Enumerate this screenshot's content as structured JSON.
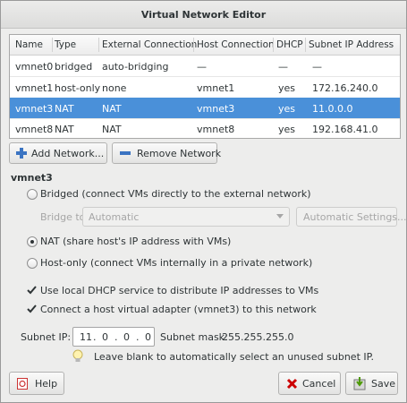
{
  "window": {
    "title": "Virtual Network Editor"
  },
  "table": {
    "columns": [
      "Name",
      "Type",
      "External Connection",
      "Host Connection",
      "DHCP",
      "Subnet IP Address"
    ],
    "rows": [
      {
        "name": "vmnet0",
        "type": "bridged",
        "external": "auto-bridging",
        "host": "—",
        "dhcp": "—",
        "subnet": "—"
      },
      {
        "name": "vmnet1",
        "type": "host-only",
        "external": "none",
        "host": "vmnet1",
        "dhcp": "yes",
        "subnet": "172.16.240.0"
      },
      {
        "name": "vmnet3",
        "type": "NAT",
        "external": "NAT",
        "host": "vmnet3",
        "dhcp": "yes",
        "subnet": "11.0.0.0"
      },
      {
        "name": "vmnet8",
        "type": "NAT",
        "external": "NAT",
        "host": "vmnet8",
        "dhcp": "yes",
        "subnet": "192.168.41.0"
      }
    ],
    "selected_row": "vmnet3"
  },
  "actions": {
    "add_network": "Add Network...",
    "remove_network": "Remove Network"
  },
  "details": {
    "section_title": "vmnet3",
    "bridged_option": "Bridged (connect VMs directly to the external network)",
    "bridge_to_label": "Bridge to:",
    "bridge_to_value": "Automatic",
    "automatic_settings": "Automatic Settings...",
    "nat_option": "NAT (share host's IP address with VMs)",
    "hostonly_option": "Host-only (connect VMs internally in a private network)",
    "selected_mode": "NAT",
    "dhcp_check": "Use local DHCP service to distribute IP addresses to VMs",
    "dhcp_checked": true,
    "adapter_check": "Connect a host virtual adapter (vmnet3) to this network",
    "adapter_checked": true,
    "subnet_ip_label": "Subnet IP:",
    "subnet_ip_octets": [
      "11",
      "0",
      "0",
      "0"
    ],
    "subnet_mask_label": "Subnet mask:",
    "subnet_mask_value": "255.255.255.0",
    "hint": "Leave blank to automatically select an unused subnet IP."
  },
  "footer": {
    "help": "Help",
    "cancel": "Cancel",
    "save": "Save"
  },
  "colors": {
    "selection": "#4a90d9",
    "add_icon": "#3b74c2",
    "cancel_icon": "#cc0000",
    "save_icon": "#4e9a06"
  }
}
